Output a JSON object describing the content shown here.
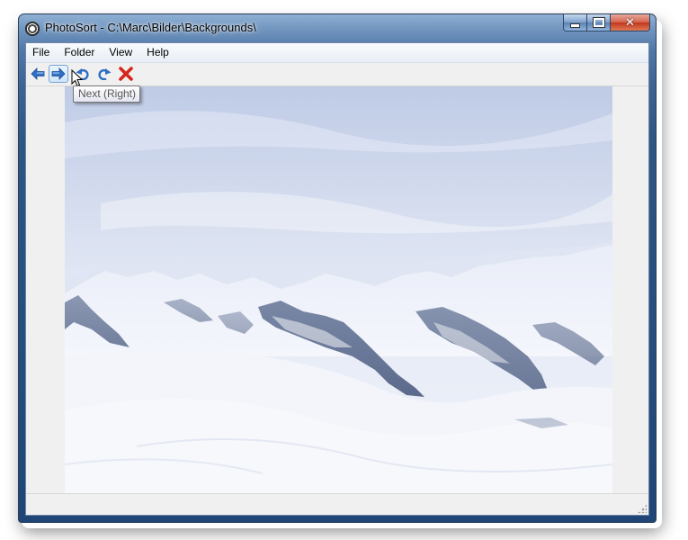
{
  "window": {
    "title": "PhotoSort - C:\\Marc\\Bilder\\Backgrounds\\"
  },
  "menu": {
    "items": [
      "File",
      "Folder",
      "View",
      "Help"
    ]
  },
  "toolbar": {
    "buttons": [
      {
        "icon": "arrow-left-icon",
        "color": "#2f6fc4"
      },
      {
        "icon": "arrow-right-icon",
        "color": "#2f6fc4"
      },
      {
        "icon": "undo-icon",
        "color": "#2f6fc4"
      },
      {
        "icon": "redo-icon",
        "color": "#2f6fc4"
      },
      {
        "icon": "delete-x-icon",
        "color": "#d7261b"
      }
    ],
    "tooltip": "Next (Right)"
  },
  "image": {
    "subject": "snowy-mountain-range-under-pale-blue-sky"
  }
}
